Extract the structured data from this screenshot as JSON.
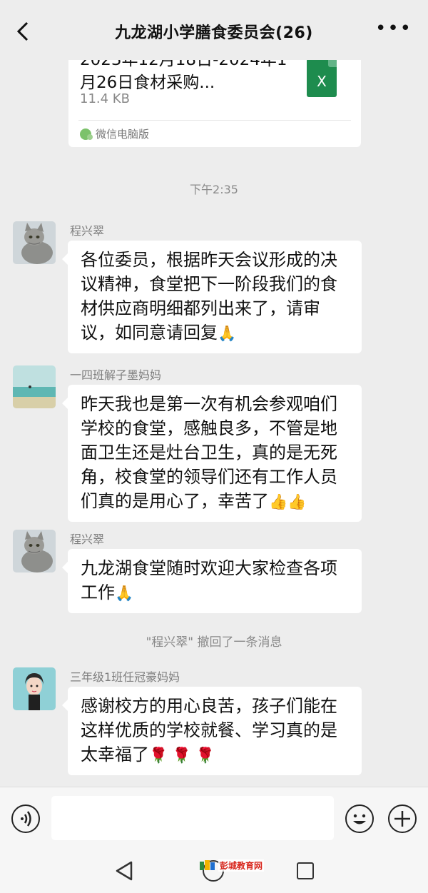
{
  "header": {
    "title": "九龙湖小学膳食委员会(26)"
  },
  "file_message": {
    "name": "2023年12月18日-2024年1月26日食材采购...",
    "size": "11.4 KB",
    "icon_label": "X",
    "source": "微信电脑版"
  },
  "timestamp": "下午2:35",
  "messages": [
    {
      "sender": "程兴翠",
      "text": "各位委员，根据昨天会议形成的决议精神，食堂把下一阶段我们的食材供应商明细都列出来了，请审议，如同意请回复",
      "emoji": "🙏"
    },
    {
      "sender": "一四班解子墨妈妈",
      "text": "昨天我也是第一次有机会参观咱们学校的食堂，感触良多，不管是地面卫生还是灶台卫生，真的是无死角，校食堂的领导们还有工作人员们真的是用心了，幸苦了",
      "emoji": "👍👍"
    },
    {
      "sender": "程兴翠",
      "text": "九龙湖食堂随时欢迎大家检查各项工作",
      "emoji": "🙏"
    },
    {
      "sender": "三年级1班任冠豪妈妈",
      "text": "感谢校方的用心良苦，孩子们能在这样优质的学校就餐、学习真的是太幸福了",
      "emoji": "🌹 🌹 🌹"
    }
  ],
  "system_notice": "\"程兴翠\" 撤回了一条消息",
  "watermark": "彭城教育网",
  "colors": {
    "background": "#ededed",
    "bubble": "#ffffff",
    "excel_green": "#1e8c4e"
  }
}
